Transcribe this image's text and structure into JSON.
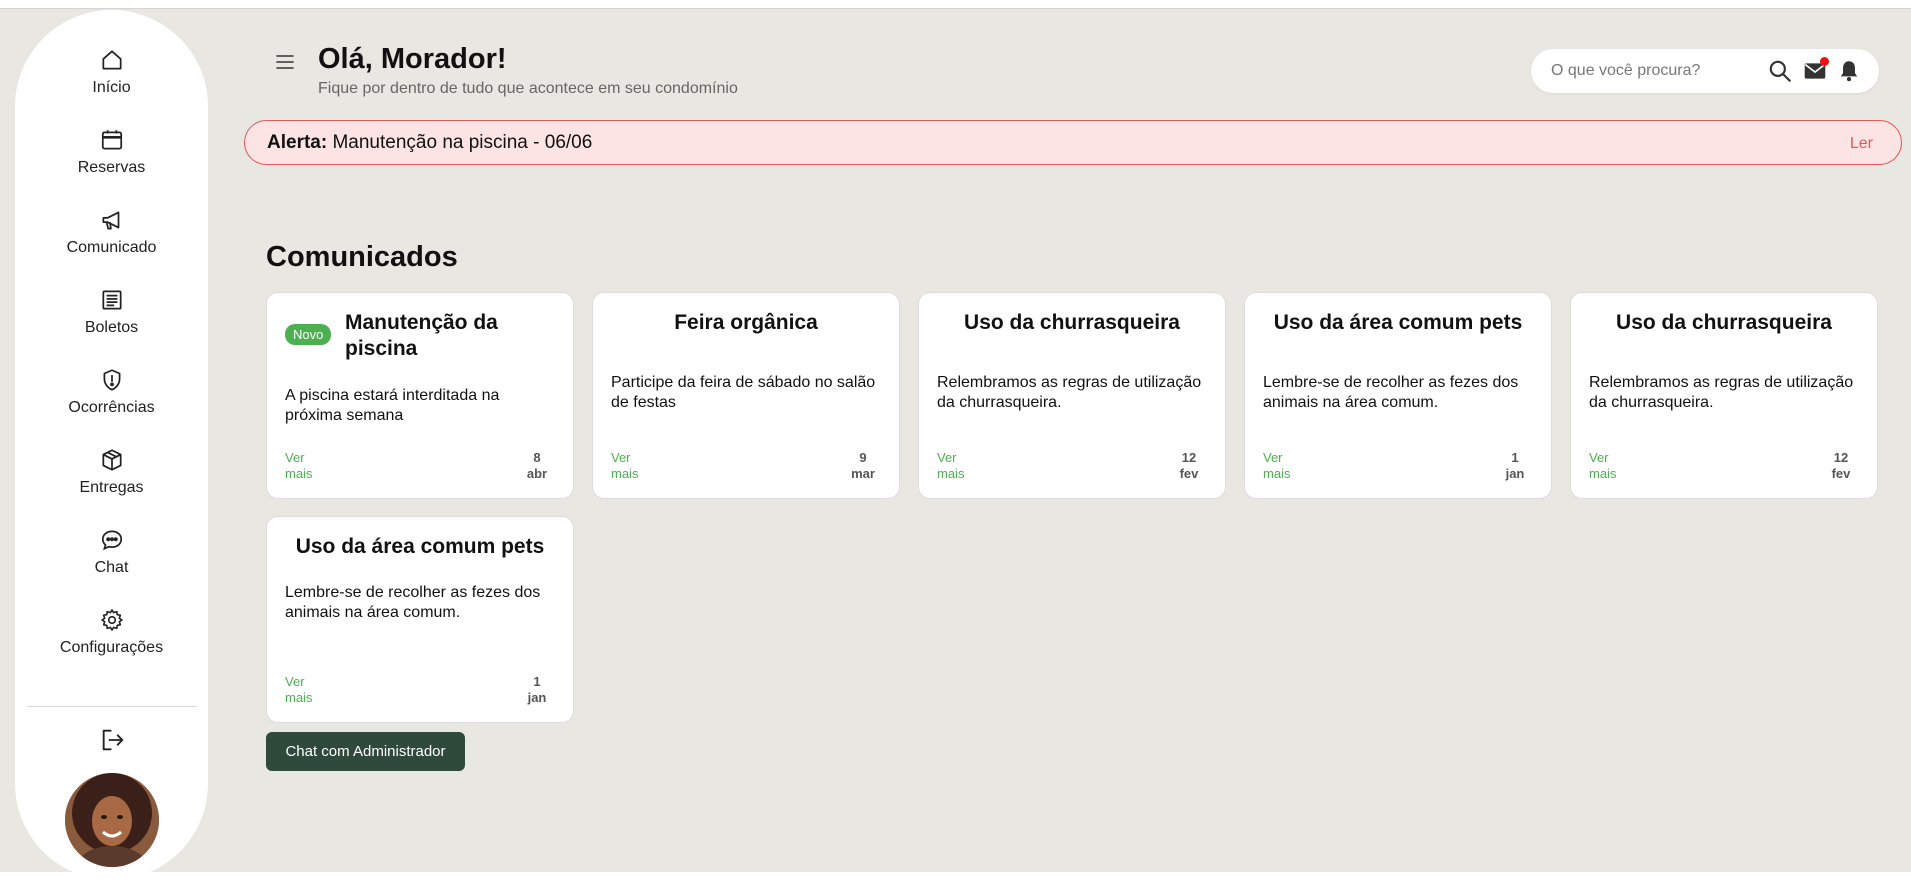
{
  "sidebar": {
    "items": [
      {
        "label": "Início",
        "icon": "home-icon"
      },
      {
        "label": "Reservas",
        "icon": "calendar-icon"
      },
      {
        "label": "Comunicado",
        "icon": "megaphone-icon"
      },
      {
        "label": "Boletos",
        "icon": "receipt-icon"
      },
      {
        "label": "Ocorrências",
        "icon": "shield-alert-icon"
      },
      {
        "label": "Entregas",
        "icon": "package-icon"
      },
      {
        "label": "Chat",
        "icon": "chat-icon"
      },
      {
        "label": "Configurações",
        "icon": "gear-icon"
      }
    ]
  },
  "header": {
    "greeting": "Olá, Morador!",
    "subtitle": "Fique por dentro de tudo que acontece em seu condomínio",
    "search_placeholder": "O que você procura?"
  },
  "alert": {
    "label": "Alerta:",
    "message": "Manutenção na piscina - 06/06",
    "action": "Ler",
    "color": "#e05a5a"
  },
  "section": {
    "title": "Comunicados"
  },
  "cards": [
    {
      "badge": "Novo",
      "title": "Manutenção da piscina",
      "body": "A piscina estará interditada na próxima semana",
      "more": "Ver mais",
      "day": "8",
      "month": "abr"
    },
    {
      "title": "Feira orgânica",
      "body": "Participe da feira de sábado no salão de festas",
      "more": "Ver mais",
      "day": "9",
      "month": "mar"
    },
    {
      "title": "Uso da churrasqueira",
      "body": "Relembramos as regras de utilização da churrasqueira.",
      "more": "Ver mais",
      "day": "12",
      "month": "fev"
    },
    {
      "title": "Uso da área comum pets",
      "body": "Lembre-se de recolher as fezes dos animais na área comum.",
      "more": "Ver mais",
      "day": "1",
      "month": "jan"
    },
    {
      "title": "Uso da churrasqueira",
      "body": "Relembramos as regras de utilização da churrasqueira.",
      "more": "Ver mais",
      "day": "12",
      "month": "fev"
    },
    {
      "title": "Uso da área comum pets",
      "body": "Lembre-se de recolher as fezes dos animais na área comum.",
      "more": "Ver mais",
      "day": "1",
      "month": "jan"
    }
  ],
  "chat_button": "Chat com Administrador",
  "colors": {
    "accent_green": "#4caf50",
    "dark_green": "#2f4a3b",
    "background": "#e9e7e2"
  }
}
